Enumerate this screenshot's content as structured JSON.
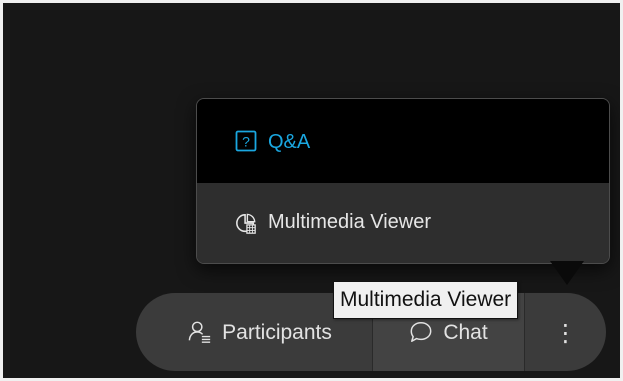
{
  "menu": {
    "items": [
      {
        "label": "Q&A",
        "icon": "qa-icon",
        "color": "#1aa7e0",
        "highlighted": true
      },
      {
        "label": "Multimedia Viewer",
        "icon": "multimedia-viewer-icon",
        "color": "#e6e6e6"
      }
    ]
  },
  "toolbar": {
    "participants_label": "Participants",
    "participants_icon": "participants-icon",
    "chat_label": "Chat",
    "chat_icon": "chat-bubble-icon",
    "more_label": "⋮",
    "more_icon": "more-options-icon"
  },
  "tooltip": {
    "text": "Multimedia Viewer"
  }
}
